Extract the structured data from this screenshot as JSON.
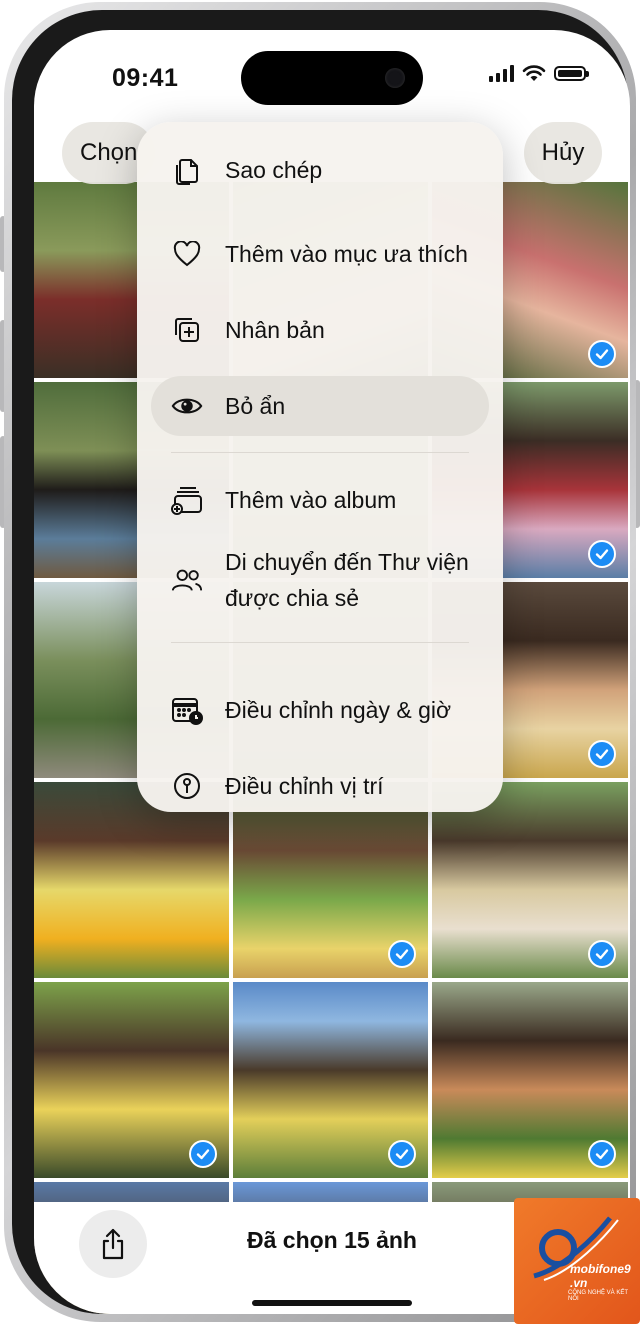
{
  "status_bar": {
    "time": "09:41"
  },
  "header": {
    "select_label": "Chọn",
    "cancel_label": "Hủy"
  },
  "context_menu": {
    "items": [
      {
        "label": "Sao chép",
        "icon": "copy-icon"
      },
      {
        "label": "Thêm vào mục ưa thích",
        "icon": "heart-icon"
      },
      {
        "label": "Nhân bản",
        "icon": "duplicate-icon"
      },
      {
        "label": "Bỏ ẩn",
        "icon": "eye-icon",
        "highlighted": true
      },
      {
        "label": "Thêm vào album",
        "icon": "add-album-icon"
      },
      {
        "label": "Di chuyển đến Thư viện được chia sẻ",
        "icon": "shared-library-icon"
      },
      {
        "label": "Điều chỉnh ngày & giờ",
        "icon": "calendar-clock-icon"
      },
      {
        "label": "Điều chỉnh vị trí",
        "icon": "location-pin-icon"
      }
    ]
  },
  "toolbar": {
    "selected_label": "Đã chọn 15 ảnh"
  },
  "watermark": {
    "brand": "mobifone9",
    "domain": ".vn",
    "tagline": "CÔNG NGHỆ VÀ KẾT NỐI"
  },
  "colors": {
    "accent": "#1C8CF5",
    "menu_bg": "#F6F3EE",
    "highlight": "#E3E0DA"
  }
}
